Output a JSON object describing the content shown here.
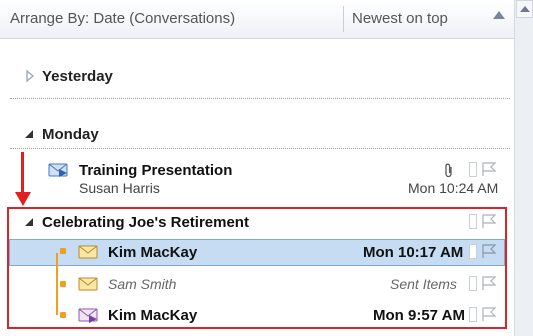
{
  "header": {
    "arrange_by": "Arrange By: Date (Conversations)",
    "sort_order": "Newest on top"
  },
  "groups": {
    "yesterday": "Yesterday",
    "monday": "Monday"
  },
  "messages": {
    "training": {
      "subject": "Training Presentation",
      "sender": "Susan Harris",
      "time": "Mon 10:24 AM",
      "has_attachment": true
    },
    "conversation": {
      "subject": "Celebrating Joe's Retirement",
      "items": [
        {
          "sender": "Kim MacKay",
          "time": "Mon 10:17 AM",
          "selected": true
        },
        {
          "sender": "Sam Smith",
          "time": "Sent Items",
          "selected": false
        },
        {
          "sender": "Kim MacKay",
          "time": "Mon 9:57 AM",
          "selected": false
        }
      ]
    }
  },
  "colors": {
    "selection": "#c6dcf3",
    "highlight_box": "#d7262a",
    "thread_line": "#f0a020"
  },
  "icons": {
    "expand_collapsed": "triangle-right-icon",
    "expand_open": "triangle-down-icon",
    "envelope": "envelope-icon",
    "attachment": "paperclip-icon",
    "flag": "flag-icon"
  }
}
